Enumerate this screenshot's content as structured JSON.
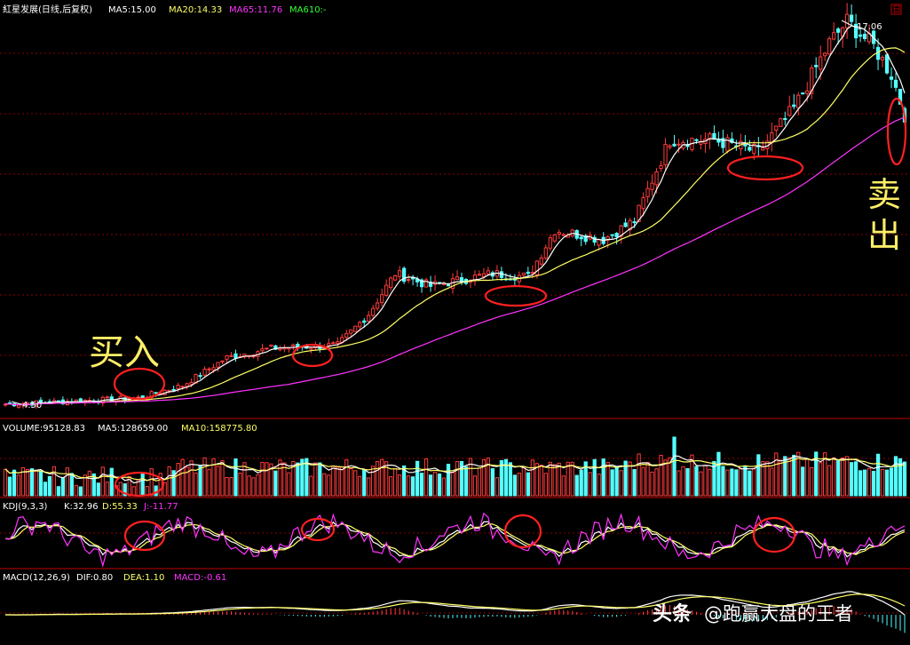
{
  "colors": {
    "background": "#000000",
    "up": "#ff3b3b",
    "down": "#54ffff",
    "ma5": "#ffffff",
    "ma20": "#ffff66",
    "ma65": "#ff33ff",
    "grid": "#8b0000",
    "divider": "#c00000",
    "annotation": "#ffee66",
    "circle": "#ff2020"
  },
  "price_panel": {
    "title": "紅星发展(日线,后复权)",
    "ma5_label": "MA5:15.00",
    "ma20_label": "MA20:14.33",
    "ma65_label": "MA65:11.76",
    "ma610_label": "MA610:-",
    "high_label": "17.06",
    "low_label": "4.50",
    "buy_label": "买入",
    "sell_label": "卖出",
    "corner_mark": "日"
  },
  "volume_panel": {
    "volume_label": "VOLUME:95128.83",
    "ma5_label": "MA5:128659.00",
    "ma10_label": "MA10:158775.80"
  },
  "kdj_panel": {
    "name_label": "KDJ(9,3,3)",
    "k_label": "K:32.96",
    "d_label": "D:55.33",
    "j_label": "J:-11.77"
  },
  "macd_panel": {
    "name_label": "MACD(12,26,9)",
    "dif_label": "DIF:0.80",
    "dea_label": "DEA:1.10",
    "macd_label": "MACD:-0.61"
  },
  "watermark": {
    "platform": "头条",
    "author": "@跑赢大盘的王者"
  },
  "chart_data": {
    "type": "candlestick",
    "title": "紅星发展(日线,后复权)",
    "price_range": [
      4.5,
      17.06
    ],
    "moving_averages": [
      "MA5",
      "MA20",
      "MA65"
    ],
    "keypoints": [
      {
        "bar": 0,
        "close": 4.7
      },
      {
        "bar": 30,
        "close": 4.9
      },
      {
        "bar": 40,
        "close": 5.3
      },
      {
        "bar": 50,
        "close": 6.2
      },
      {
        "bar": 60,
        "close": 6.5
      },
      {
        "bar": 75,
        "close": 6.6
      },
      {
        "bar": 82,
        "close": 7.6
      },
      {
        "bar": 88,
        "close": 8.9
      },
      {
        "bar": 96,
        "close": 8.5
      },
      {
        "bar": 110,
        "close": 8.9
      },
      {
        "bar": 118,
        "close": 8.8
      },
      {
        "bar": 124,
        "close": 10.3
      },
      {
        "bar": 135,
        "close": 10.0
      },
      {
        "bar": 142,
        "close": 10.6
      },
      {
        "bar": 150,
        "close": 13.2
      },
      {
        "bar": 160,
        "close": 13.2
      },
      {
        "bar": 170,
        "close": 12.8
      },
      {
        "bar": 178,
        "close": 14.2
      },
      {
        "bar": 186,
        "close": 16.3
      },
      {
        "bar": 190,
        "close": 17.0
      },
      {
        "bar": 196,
        "close": 16.2
      },
      {
        "bar": 200,
        "close": 15.3
      },
      {
        "bar": 203,
        "close": 14.0
      }
    ],
    "bar_count": 204,
    "buy_bar": 37,
    "sell_bar": 203
  }
}
